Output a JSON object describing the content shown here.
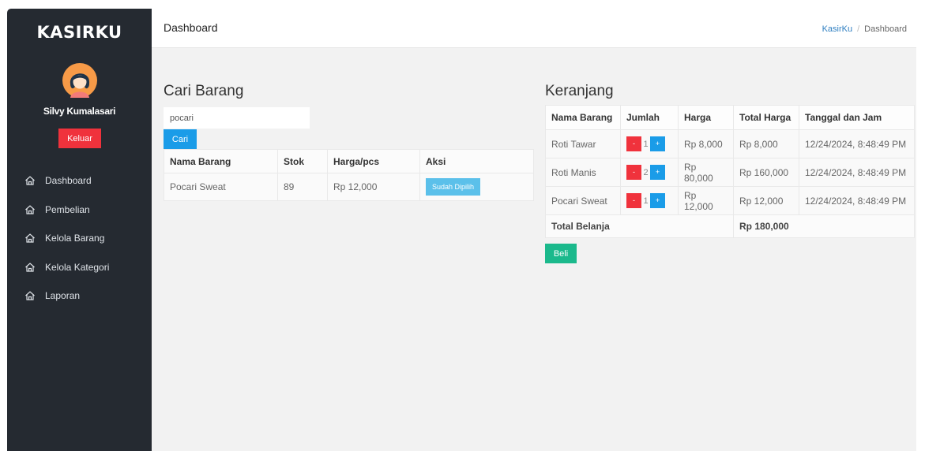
{
  "sidebar": {
    "brand": "KASIRKU",
    "user_name": "Silvy Kumalasari",
    "logout_label": "Keluar",
    "items": [
      {
        "label": "Dashboard",
        "icon": "home-icon"
      },
      {
        "label": "Pembelian",
        "icon": "home-icon"
      },
      {
        "label": "Kelola Barang",
        "icon": "home-icon"
      },
      {
        "label": "Kelola Kategori",
        "icon": "home-icon"
      },
      {
        "label": "Laporan",
        "icon": "home-icon"
      }
    ]
  },
  "header": {
    "title": "Dashboard",
    "breadcrumb": {
      "link": "KasirKu",
      "separator": "/",
      "current": "Dashboard"
    }
  },
  "search": {
    "title": "Cari Barang",
    "value": "pocari",
    "button_label": "Cari",
    "table": {
      "headers": [
        "Nama Barang",
        "Stok",
        "Harga/pcs",
        "Aksi"
      ],
      "rows": [
        {
          "name": "Pocari Sweat",
          "stock": "89",
          "price": "Rp 12,000",
          "action": "Sudah Dipilih"
        }
      ]
    }
  },
  "cart": {
    "title": "Keranjang",
    "headers": [
      "Nama Barang",
      "Jumlah",
      "Harga",
      "Total Harga",
      "Tanggal dan Jam"
    ],
    "minus_label": "-",
    "plus_label": "+",
    "rows": [
      {
        "name": "Roti Tawar",
        "qty": "1",
        "price": "Rp 8,000",
        "total": "Rp 8,000",
        "datetime": "12/24/2024, 8:48:49 PM"
      },
      {
        "name": "Roti Manis",
        "qty": "2",
        "price": "Rp 80,000",
        "total": "Rp 160,000",
        "datetime": "12/24/2024, 8:48:49 PM"
      },
      {
        "name": "Pocari Sweat",
        "qty": "1",
        "price": "Rp 12,000",
        "total": "Rp 12,000",
        "datetime": "12/24/2024, 8:48:49 PM"
      }
    ],
    "total_label": "Total Belanja",
    "total_value": "Rp 180,000",
    "buy_label": "Beli"
  },
  "colors": {
    "sidebar_bg": "#252a31",
    "danger": "#f0323c",
    "primary": "#1a9ce8",
    "info": "#5bc0ea",
    "success": "#1bb98c"
  }
}
